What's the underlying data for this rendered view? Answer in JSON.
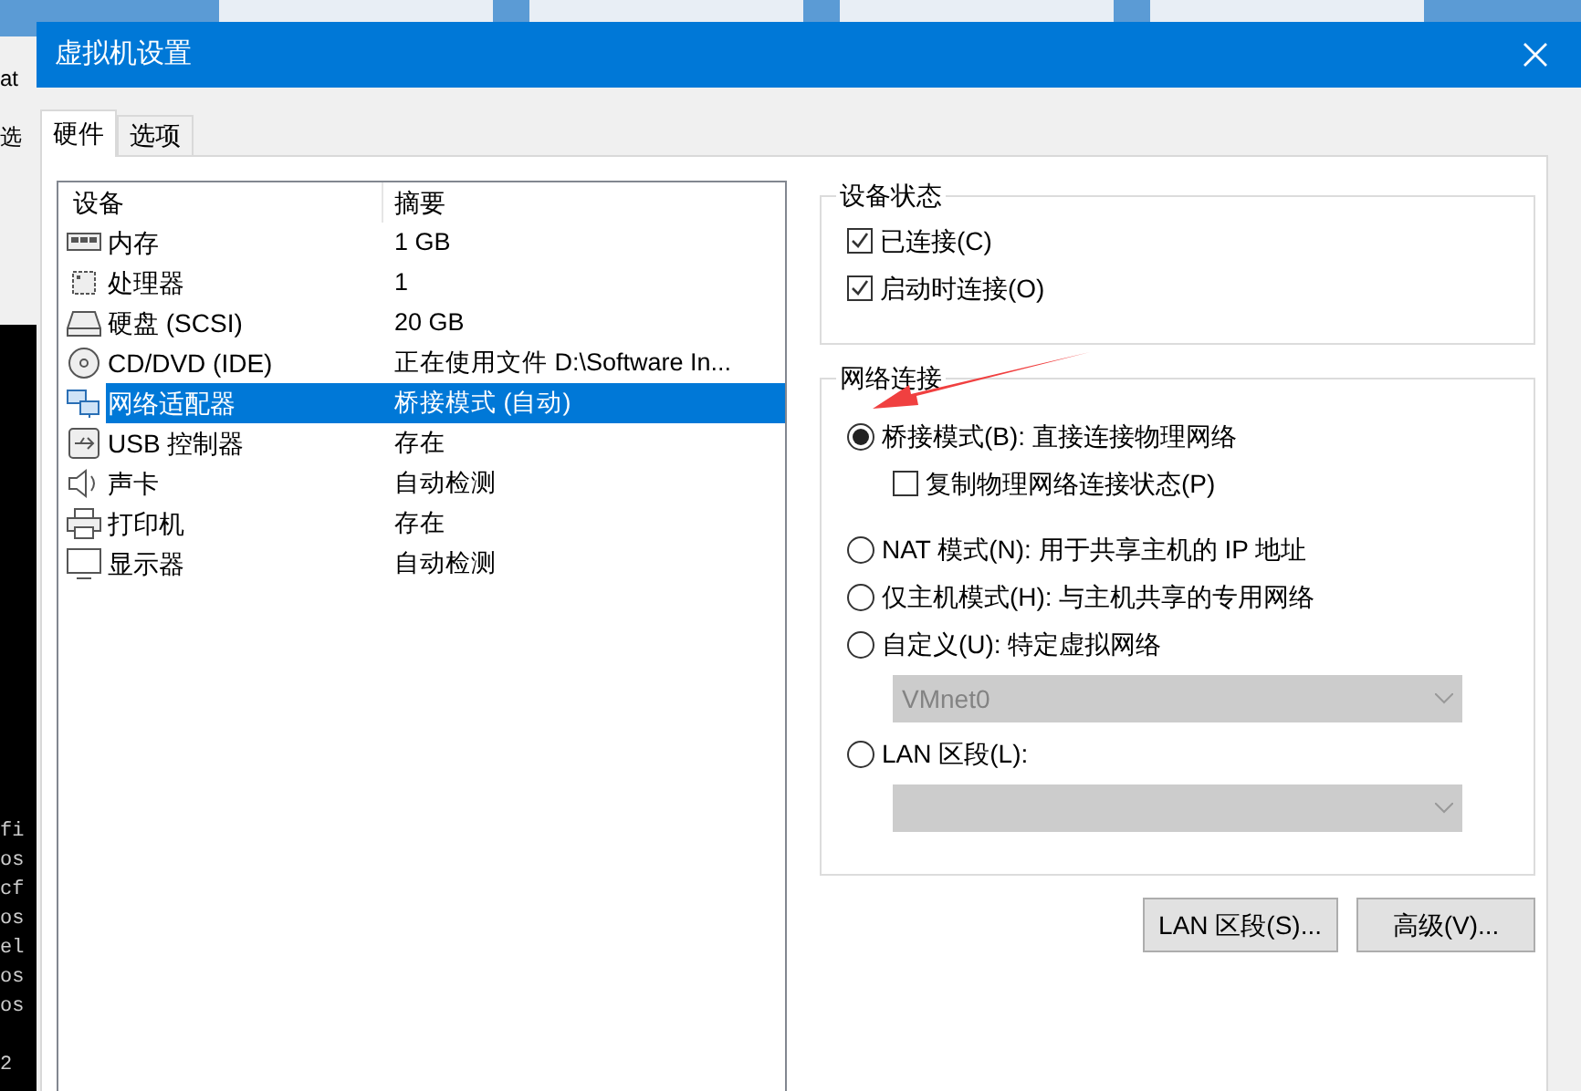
{
  "background": {
    "left_fragments": [
      "at",
      "选"
    ],
    "terminal_lines": [
      "fi",
      "os",
      "cf",
      "os",
      "el",
      "os",
      "os"
    ],
    "terminal_tail": "2"
  },
  "window": {
    "title": "虚拟机设置"
  },
  "tabs": [
    {
      "label": "硬件",
      "selected": true
    },
    {
      "label": "选项",
      "selected": false
    }
  ],
  "device_table": {
    "columns": [
      "设备",
      "摘要"
    ],
    "rows": [
      {
        "kind": "memory",
        "device": "内存",
        "summary": "1 GB",
        "selected": false
      },
      {
        "kind": "cpu",
        "device": "处理器",
        "summary": "1",
        "selected": false
      },
      {
        "kind": "disk",
        "device": "硬盘 (SCSI)",
        "summary": "20 GB",
        "selected": false
      },
      {
        "kind": "cd",
        "device": "CD/DVD (IDE)",
        "summary": "正在使用文件 D:\\Software In...",
        "selected": false
      },
      {
        "kind": "network",
        "device": "网络适配器",
        "summary": "桥接模式 (自动)",
        "selected": true
      },
      {
        "kind": "usb",
        "device": "USB 控制器",
        "summary": "存在",
        "selected": false
      },
      {
        "kind": "sound",
        "device": "声卡",
        "summary": "自动检测",
        "selected": false
      },
      {
        "kind": "printer",
        "device": "打印机",
        "summary": "存在",
        "selected": false
      },
      {
        "kind": "monitor",
        "device": "显示器",
        "summary": "自动检测",
        "selected": false
      }
    ]
  },
  "device_status": {
    "title": "设备状态",
    "options": [
      {
        "label": "已连接(C)",
        "checked": true
      },
      {
        "label": "启动时连接(O)",
        "checked": true
      }
    ]
  },
  "network_connection": {
    "title": "网络连接",
    "items": [
      {
        "kind": "radio",
        "label": "桥接模式(B): 直接连接物理网络",
        "selected": true
      },
      {
        "kind": "checkbox",
        "label": "复制物理网络连接状态(P)",
        "checked": false
      },
      {
        "kind": "radio",
        "label": "NAT 模式(N): 用于共享主机的 IP 地址",
        "selected": false
      },
      {
        "kind": "radio",
        "label": "仅主机模式(H): 与主机共享的专用网络",
        "selected": false
      },
      {
        "kind": "radio",
        "label": "自定义(U): 特定虚拟网络",
        "selected": false
      },
      {
        "kind": "dropdown",
        "value": "VMnet0",
        "disabled": true
      },
      {
        "kind": "radio",
        "label": "LAN 区段(L):",
        "selected": false
      },
      {
        "kind": "dropdown",
        "disabled": true
      }
    ]
  },
  "buttons": [
    "LAN 区段(S)...",
    "高级(V)..."
  ]
}
